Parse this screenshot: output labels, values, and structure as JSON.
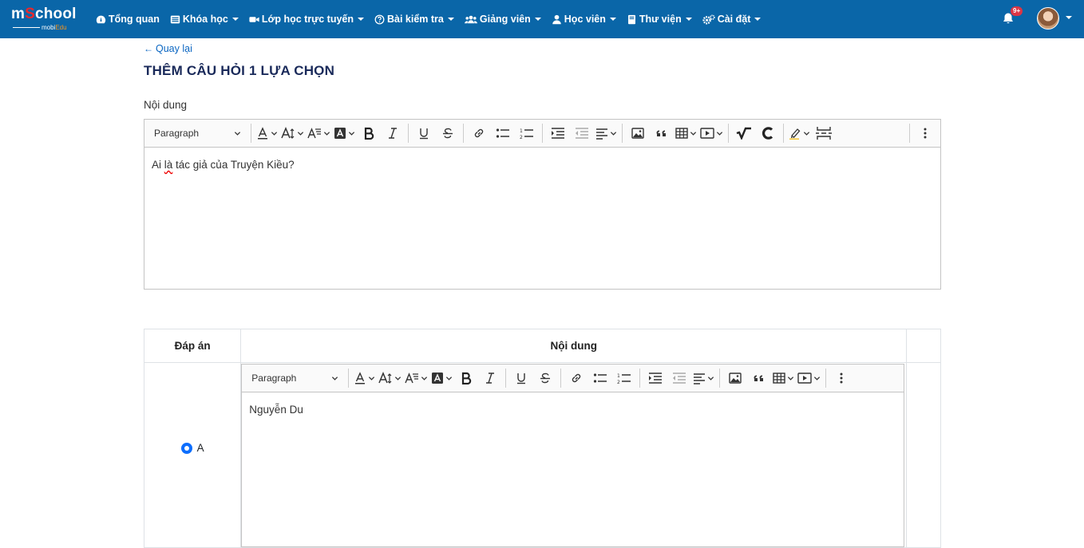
{
  "brand": {
    "logo_main_a": "m",
    "logo_main_dot": "S",
    "logo_main_b": "chool",
    "logo_sub_a": "mobi",
    "logo_sub_b": "Edu"
  },
  "nav": {
    "items": [
      {
        "label": "Tổng quan",
        "icon": "dashboard-icon",
        "dropdown": false
      },
      {
        "label": "Khóa học",
        "icon": "list-icon",
        "dropdown": true
      },
      {
        "label": "Lớp học trực tuyến",
        "icon": "video-icon",
        "dropdown": true
      },
      {
        "label": "Bài kiểm tra",
        "icon": "question-circle-icon",
        "dropdown": true
      },
      {
        "label": "Giảng viên",
        "icon": "users-icon",
        "dropdown": true
      },
      {
        "label": "Học viên",
        "icon": "user-icon",
        "dropdown": true
      },
      {
        "label": "Thư viện",
        "icon": "book-icon",
        "dropdown": true
      },
      {
        "label": "Cài đặt",
        "icon": "cogs-icon",
        "dropdown": true
      }
    ],
    "notification_badge": "9+"
  },
  "page": {
    "back_label": "Quay lại",
    "title": "THÊM CÂU HỎI 1 LỰA CHỌN",
    "content_label": "Nội dung"
  },
  "editor": {
    "paragraph_label": "Paragraph",
    "content_pre": "Ai ",
    "content_misspelled": "là",
    "content_post": " tác giả của Truyện Kiều?"
  },
  "answers_table": {
    "headers": [
      "Đáp án",
      "Nội dung",
      ""
    ],
    "rows": [
      {
        "letter": "A",
        "selected": true,
        "paragraph_label": "Paragraph",
        "content": "Nguyễn Du"
      }
    ]
  },
  "colors": {
    "navbar": "#0a66a8",
    "accent": "#0d6efd",
    "title": "#1a2a5a",
    "badge": "#dc3545"
  }
}
